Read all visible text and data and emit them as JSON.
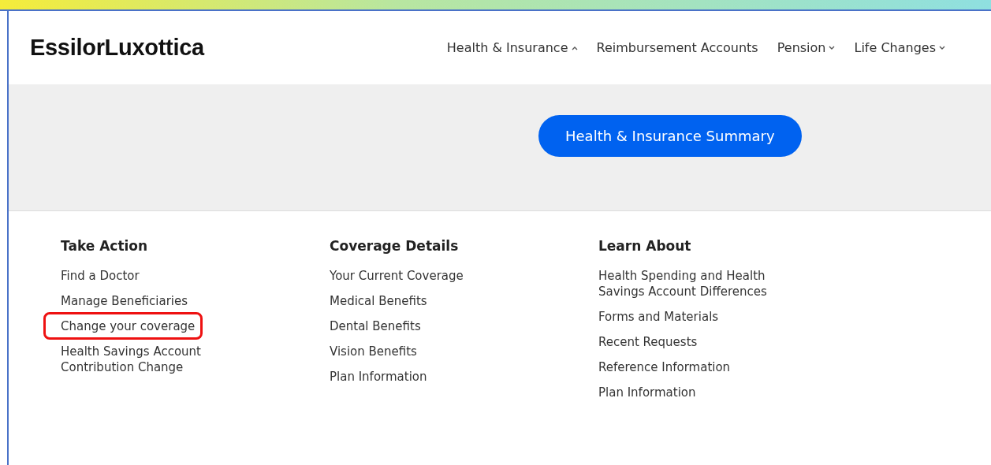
{
  "header": {
    "logo": "EssilorLuxottica",
    "nav": [
      {
        "label": "Health & Insurance",
        "kind": "dropdown",
        "expanded": true
      },
      {
        "label": "Reimbursement Accounts",
        "kind": "link"
      },
      {
        "label": "Pension",
        "kind": "dropdown",
        "expanded": false
      },
      {
        "label": "Life Changes",
        "kind": "dropdown",
        "expanded": false
      }
    ]
  },
  "banner": {
    "button": "Health & Insurance Summary"
  },
  "columns": [
    {
      "title": "Take Action",
      "links": [
        {
          "label": "Find a Doctor",
          "highlighted": false
        },
        {
          "label": "Manage Beneficiaries",
          "highlighted": false
        },
        {
          "label": "Change your coverage",
          "highlighted": true
        },
        {
          "label": "Health Savings Account Contribution Change",
          "highlighted": false
        }
      ]
    },
    {
      "title": "Coverage Details",
      "links": [
        {
          "label": "Your Current Coverage",
          "highlighted": false
        },
        {
          "label": "Medical Benefits",
          "highlighted": false
        },
        {
          "label": "Dental Benefits",
          "highlighted": false
        },
        {
          "label": "Vision Benefits",
          "highlighted": false
        },
        {
          "label": "Plan Information",
          "highlighted": false
        }
      ]
    },
    {
      "title": "Learn About",
      "links": [
        {
          "label": "Health Spending and Health Savings Account Differences",
          "highlighted": false
        },
        {
          "label": "Forms and Materials",
          "highlighted": false
        },
        {
          "label": "Recent Requests",
          "highlighted": false
        },
        {
          "label": "Reference Information",
          "highlighted": false
        },
        {
          "label": "Plan Information",
          "highlighted": false
        }
      ]
    }
  ]
}
